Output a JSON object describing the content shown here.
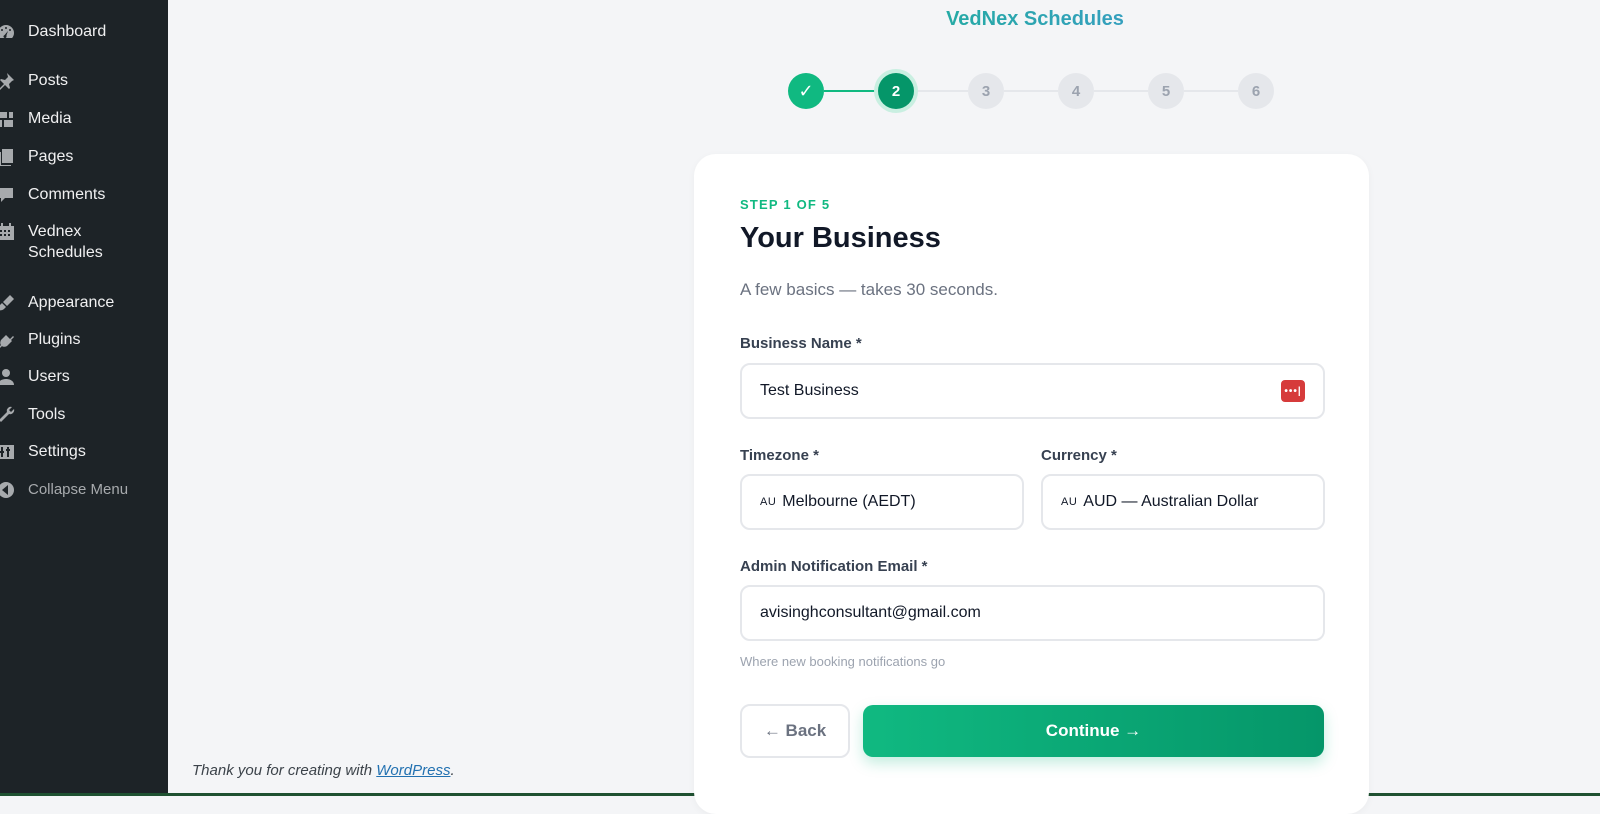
{
  "sidebar": {
    "items": [
      {
        "label": "Dashboard",
        "icon": "dashboard-icon"
      },
      {
        "label": "Posts",
        "icon": "pin-icon"
      },
      {
        "label": "Media",
        "icon": "media-icon"
      },
      {
        "label": "Pages",
        "icon": "pages-icon"
      },
      {
        "label": "Comments",
        "icon": "comment-icon"
      },
      {
        "label": "Vednex Schedules",
        "icon": "calendar-icon"
      },
      {
        "label": "Appearance",
        "icon": "paintbrush-icon"
      },
      {
        "label": "Plugins",
        "icon": "plugin-icon"
      },
      {
        "label": "Users",
        "icon": "user-icon"
      },
      {
        "label": "Tools",
        "icon": "wrench-icon"
      },
      {
        "label": "Settings",
        "icon": "settings-icon"
      },
      {
        "label": "Collapse Menu",
        "icon": "collapse-icon"
      }
    ]
  },
  "footer": {
    "text": "Thank you for creating with ",
    "link_label": "WordPress",
    "suffix": "."
  },
  "brand": {
    "title": "VedNex Schedules"
  },
  "stepper": {
    "steps": [
      "✓",
      "2",
      "3",
      "4",
      "5",
      "6"
    ],
    "completed_count": 1,
    "active_index": 1
  },
  "form": {
    "step_label": "STEP 1 OF 5",
    "title": "Your Business",
    "subtitle": "A few basics — takes 30 seconds.",
    "business_name": {
      "label": "Business Name *",
      "value": "Test Business"
    },
    "timezone": {
      "label": "Timezone *",
      "flag": "AU",
      "value": "Melbourne (AEDT)"
    },
    "currency": {
      "label": "Currency *",
      "flag": "AU",
      "value": "AUD — Australian Dollar"
    },
    "email": {
      "label": "Admin Notification Email *",
      "value": "avisinghconsultant@gmail.com",
      "hint": "Where new booking notifications go"
    },
    "back_label": "← Back",
    "continue_label": "Continue →"
  },
  "colors": {
    "sidebar_bg": "#1d2327",
    "accent": "#10b981",
    "accent_dark": "#059669"
  }
}
